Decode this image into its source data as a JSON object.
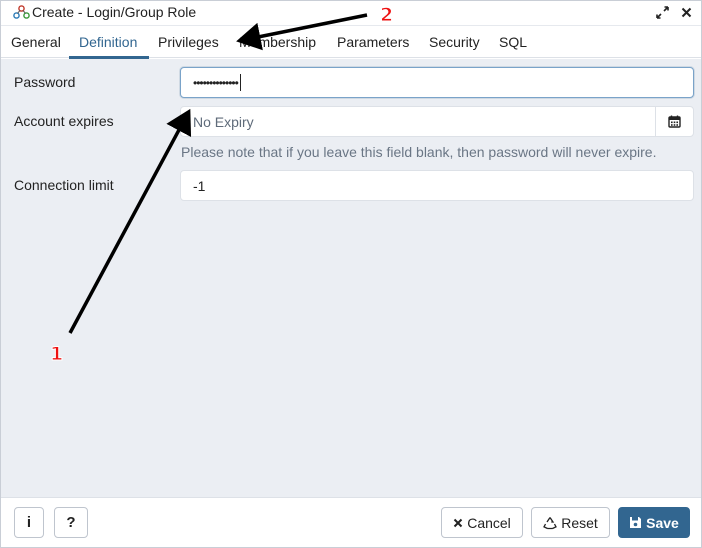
{
  "window": {
    "title": "Create - Login/Group Role",
    "expand_icon": "expand-icon",
    "close_icon": "close-icon"
  },
  "tabs": [
    {
      "label": "General"
    },
    {
      "label": "Definition",
      "active": true
    },
    {
      "label": "Privileges"
    },
    {
      "label": "Membership"
    },
    {
      "label": "Parameters"
    },
    {
      "label": "Security"
    },
    {
      "label": "SQL"
    }
  ],
  "form": {
    "password": {
      "label": "Password",
      "value": "••••••••••••••"
    },
    "account_expires": {
      "label": "Account expires",
      "placeholder": "No Expiry",
      "help": "Please note that if you leave this field blank, then password will never expire."
    },
    "connection_limit": {
      "label": "Connection limit",
      "value": "-1"
    }
  },
  "footer": {
    "info_label": "i",
    "help_label": "?",
    "cancel_label": "Cancel",
    "reset_label": "Reset",
    "save_label": "Save"
  },
  "annotations": {
    "marker_1": "1",
    "marker_2": "2",
    "arrow_color": "#000000",
    "marker_color": "#e11111"
  },
  "colors": {
    "accent": "#326690",
    "content_bg": "#ebeef3"
  }
}
